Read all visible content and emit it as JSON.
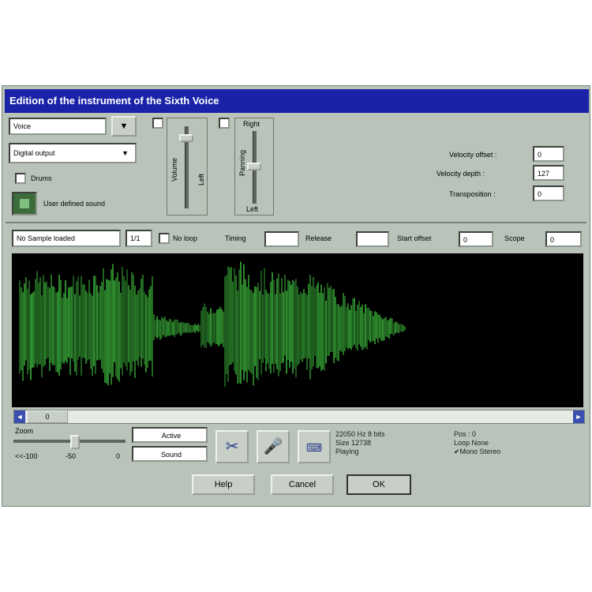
{
  "window": {
    "title": "Edition of the instrument of the Sixth Voice"
  },
  "instrument": {
    "name_value": "Voice",
    "output_value": "Digital output",
    "name_arrow": "▼",
    "output_arrow": "▼"
  },
  "checkboxes": {
    "drums_label": "Drums",
    "user_sound_label": "User defined sound"
  },
  "sliders": {
    "group1_label": "Volume",
    "group1_sub": "Left",
    "group2_label": "Panning",
    "group2_top": "Right",
    "group2_bottom": "Left"
  },
  "params": {
    "velocity_offset_label": "Velocity offset :",
    "velocity_offset_value": "0",
    "velocity_depth_label": "Velocity depth :",
    "velocity_depth_value": "127",
    "transposition_label": "Transposition :",
    "transposition_value": "0"
  },
  "sample_row": {
    "sample_select": "No Sample loaded",
    "sample_num": "1/1",
    "loop_label": "No loop",
    "timing_label": "Timing",
    "timing_value": "",
    "release_label": "Release",
    "release_value": "",
    "start_label": "Start offset",
    "start_value": "0",
    "scope_label": "Scope",
    "scope_value": "0"
  },
  "scroll": {
    "left_arrow": "◄",
    "right_arrow": "►",
    "pos_label": "0"
  },
  "bottom": {
    "zoom_label": "Zoom",
    "range_left": "<<-100",
    "range_mid": "-50",
    "range_right": "0",
    "combo1": "Active",
    "combo2": "Sound",
    "info1_line1": "22050 Hz  8 bits",
    "info1_line2": "Size  12738",
    "info1_line3": "Playing",
    "info2_line1": "Pos : 0",
    "info2_line2": "Loop  None",
    "info2_line3": "Mono  Stereo"
  },
  "buttons": {
    "help": "Help",
    "cancel": "Cancel",
    "ok": "OK"
  },
  "colors": {
    "titlebar": "#1a23a8",
    "waveform": "#2f8f2f",
    "waveform_bg": "#000000",
    "window_bg": "#b9c3b9"
  }
}
